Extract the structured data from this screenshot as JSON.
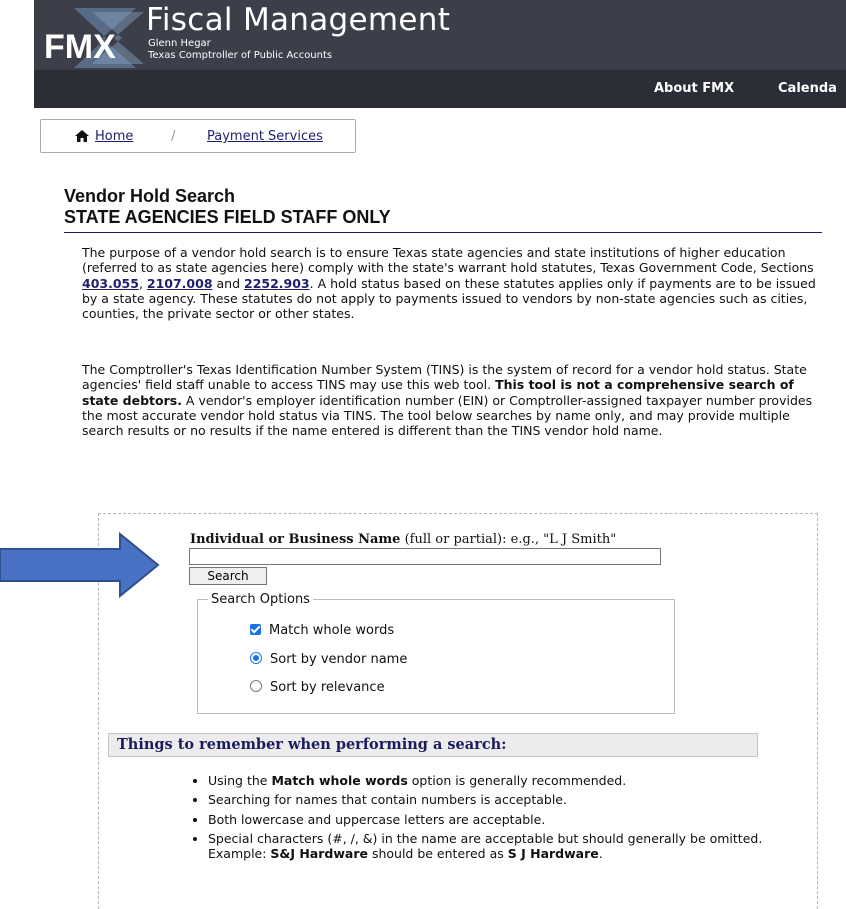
{
  "header": {
    "logo_text": "FMX",
    "title": "Fiscal Management",
    "subtitle_name": "Glenn Hegar",
    "subtitle_role": "Texas Comptroller of Public Accounts",
    "nav": [
      "About FMX",
      "Calenda"
    ]
  },
  "breadcrumb": {
    "home": "Home",
    "separator": "/",
    "current": "Payment Services"
  },
  "page": {
    "title_line1": "Vendor Hold Search",
    "title_line2": "STATE AGENCIES FIELD STAFF ONLY"
  },
  "intro": {
    "p1_part1": "The purpose of a vendor hold search is to ensure Texas state agencies and state institutions of higher education (referred to as state agencies here) comply with the state's warrant hold statutes, Texas Government Code, Sections ",
    "link1": "403.055",
    "sep1": ", ",
    "link2": "2107.008",
    "sep2": " and ",
    "link3": "2252.903",
    "p1_part2": ". A hold status based on these statutes applies only if payments are to be issued by a state agency. These statutes do not apply to payments issued to vendors by non-state agencies such as cities, counties, the private sector or other states.",
    "p2_part1": "The Comptroller's Texas Identification Number System (TINS) is the system of record for a vendor hold status. State agencies' field staff unable to access TINS may use this web tool. ",
    "p2_bold": "This tool is not a comprehensive search of state debtors.",
    "p2_part2": " A vendor's employer identification number (EIN) or Comptroller-assigned taxpayer number provides the most accurate vendor hold status via TINS. The tool below searches by name only, and may provide multiple search results or no results if the name entered is different than the TINS vendor hold name."
  },
  "search": {
    "label_bold": "Individual or Business Name",
    "label_rest": " (full or partial): e.g., \"L J Smith\"",
    "input_value": "",
    "button": "Search",
    "options_legend": "Search Options",
    "opt_match": "Match whole words",
    "opt_sort_name": "Sort by vendor name",
    "opt_sort_relevance": "Sort by relevance"
  },
  "tips": {
    "title": "Things to remember when performing a search:",
    "item1_pre": "Using the ",
    "item1_bold": "Match whole words",
    "item1_post": " option is generally recommended.",
    "item2": "Searching for names that contain numbers is acceptable.",
    "item3": "Both lowercase and uppercase letters are acceptable.",
    "item4_line1": "Special characters (#, /, &) in the name are acceptable but should generally be omitted.",
    "item4_ex_pre": "Example: ",
    "item4_ex_bold1": "S&J Hardware",
    "item4_ex_mid": " should be entered as ",
    "item4_ex_bold2": "S J Hardware",
    "item4_ex_end": "."
  },
  "colors": {
    "brand_bar": "#3c3e4a",
    "nav_bar": "#2b2d37",
    "link": "#1f1f6e",
    "accent": "#1a73e8",
    "arrow": "#4a72c4"
  }
}
